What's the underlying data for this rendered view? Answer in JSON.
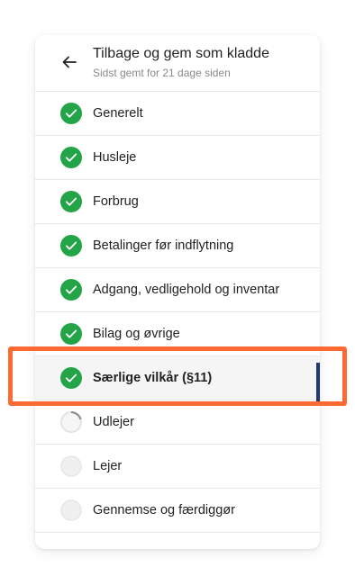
{
  "header": {
    "title": "Tilbage og gem som kladde",
    "subtitle": "Sidst gemt for 21 dage siden",
    "back_icon": "arrow-left-icon"
  },
  "steps": [
    {
      "label": "Generelt",
      "status": "done"
    },
    {
      "label": "Husleje",
      "status": "done"
    },
    {
      "label": "Forbrug",
      "status": "done"
    },
    {
      "label": "Betalinger før indflytning",
      "status": "done"
    },
    {
      "label": "Adgang, vedligehold og inventar",
      "status": "done"
    },
    {
      "label": "Bilag og øvrige",
      "status": "done"
    },
    {
      "label": "Særlige vilkår (§11)",
      "status": "done",
      "active": true
    },
    {
      "label": "Udlejer",
      "status": "in-progress"
    },
    {
      "label": "Lejer",
      "status": "todo"
    },
    {
      "label": "Gennemse og færdiggør",
      "status": "todo"
    }
  ],
  "colors": {
    "done": "#22a447",
    "active_bar": "#1f3a6b",
    "highlight": "#ff6a33",
    "todo_fill": "#f0f0f0"
  }
}
